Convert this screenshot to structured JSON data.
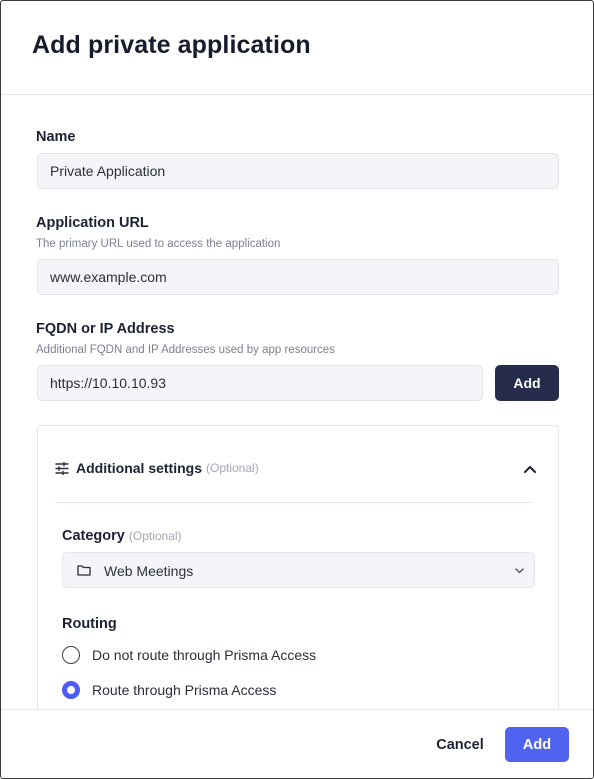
{
  "dialog": {
    "title": "Add private application"
  },
  "form": {
    "name": {
      "label": "Name",
      "value": "Private Application"
    },
    "app_url": {
      "label": "Application URL",
      "help": "The primary URL used to access the application",
      "value": "www.example.com"
    },
    "fqdn": {
      "label": "FQDN or IP Address",
      "help": "Additional FQDN and IP Addresses used by app resources",
      "value": "https://10.10.10.93",
      "add_label": "Add"
    }
  },
  "additional_settings": {
    "title": "Additional settings",
    "optional": "(Optional)",
    "expanded": true,
    "category": {
      "label": "Category",
      "optional": "(Optional)",
      "value": "Web Meetings",
      "icon": "folder-icon"
    },
    "routing": {
      "label": "Routing",
      "options": [
        {
          "label": "Do not route through Prisma Access",
          "selected": false
        },
        {
          "label": "Route through Prisma Access",
          "selected": true
        }
      ]
    }
  },
  "footer": {
    "cancel_label": "Cancel",
    "add_label": "Add"
  },
  "colors": {
    "primary": "#5063f0",
    "dark_button": "#262c4c",
    "radio_selected": "#4d5cf2"
  }
}
